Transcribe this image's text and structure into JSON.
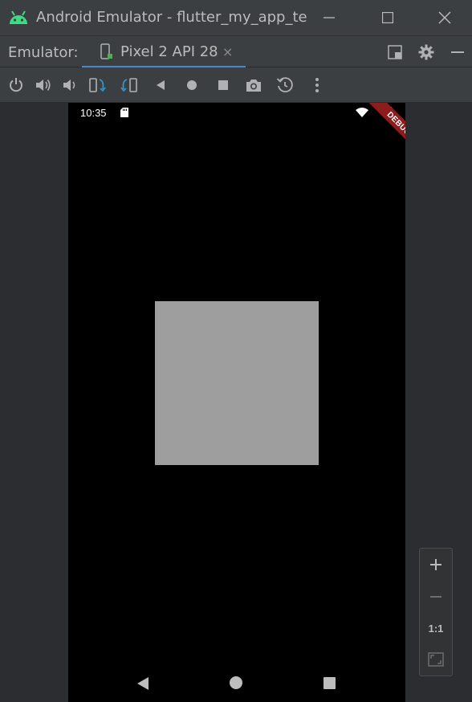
{
  "window": {
    "title": "Android Emulator - flutter_my_app_te",
    "minimize_icon": "minimize-icon",
    "maximize_icon": "maximize-icon",
    "close_icon": "close-icon"
  },
  "tabbar": {
    "label": "Emulator:",
    "tab": {
      "label": "Pixel 2 API 28",
      "close_glyph": "×",
      "active": true
    },
    "right_icons": [
      "layout-icon",
      "gear-icon",
      "minimize-panel-icon"
    ]
  },
  "toolbar": {
    "tools": [
      "power-icon",
      "volume-up-icon",
      "volume-down-icon",
      "rotate-left-icon",
      "rotate-right-icon",
      "back-icon",
      "home-icon",
      "overview-icon",
      "camera-icon",
      "snapshot-icon",
      "more-icon"
    ]
  },
  "device": {
    "status_time": "10:35",
    "debug_banner": "DEBUG",
    "box_color": "#9e9e9e",
    "screen_background": "#000000"
  },
  "zoom": {
    "zoom_in": "+",
    "zoom_out": "−",
    "one_to_one": "1:1",
    "fit_icon": "fit-screen-icon"
  },
  "colors": {
    "accent": "#4a88c7",
    "android_green": "#3ddc84",
    "debug_red": "#8b1d1d"
  }
}
